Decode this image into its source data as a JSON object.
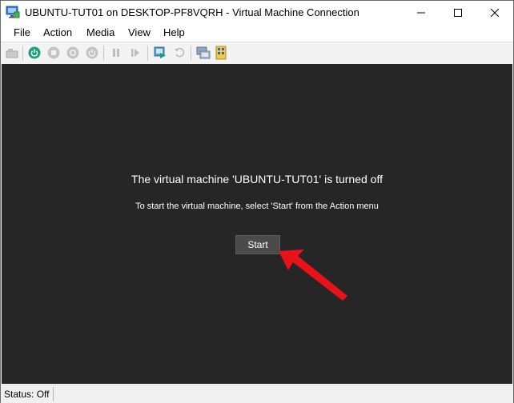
{
  "window": {
    "title": "UBUNTU-TUT01 on DESKTOP-PF8VQRH - Virtual Machine Connection"
  },
  "menu": {
    "items": [
      "File",
      "Action",
      "Media",
      "View",
      "Help"
    ]
  },
  "toolbar": {
    "icons": [
      "ctrl-alt-del-icon",
      "start-icon",
      "turn-off-icon",
      "shut-down-icon",
      "save-icon",
      "pause-icon",
      "resume-icon",
      "checkpoint-icon",
      "revert-icon",
      "enhanced-session-icon",
      "share-icon"
    ]
  },
  "console": {
    "message_title": "The virtual machine 'UBUNTU-TUT01' is turned off",
    "message_sub": "To start the virtual machine, select 'Start' from the Action menu",
    "start_label": "Start",
    "annotation_arrow_color": "#e8121a"
  },
  "status": {
    "text": "Status: Off"
  },
  "colors": {
    "console_bg": "#262626",
    "start_button_bg": "#4a4a4a",
    "power_green": "#1e9f7a"
  }
}
